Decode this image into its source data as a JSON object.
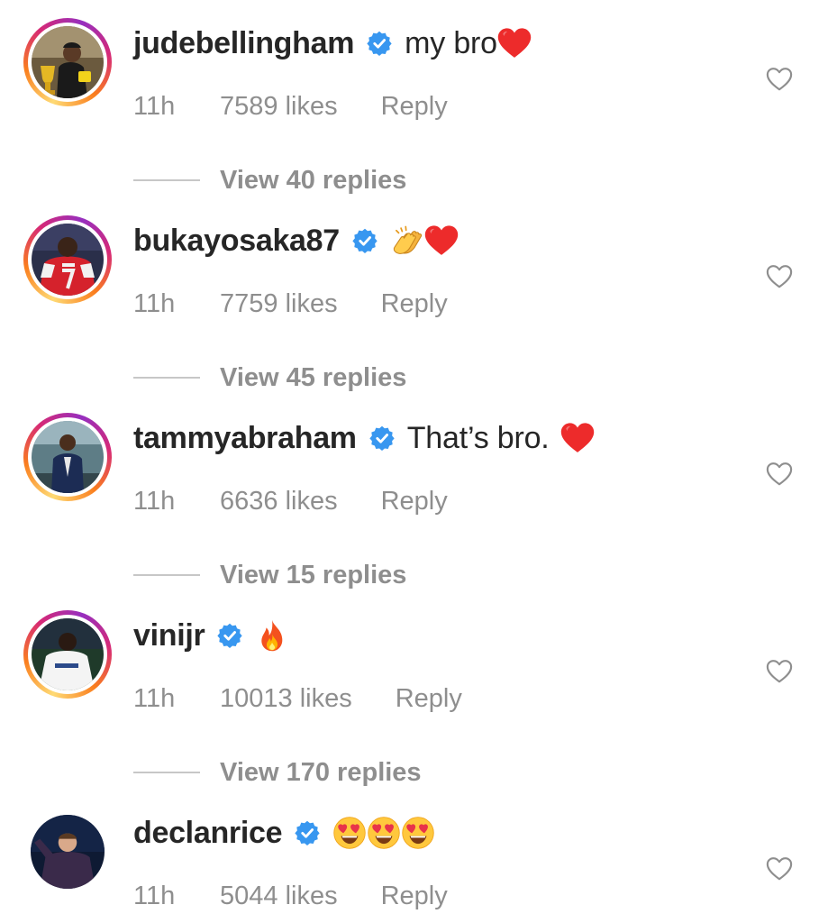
{
  "colors": {
    "text_primary": "#262626",
    "text_secondary": "#8e8e8e",
    "verified_blue": "#3897f0",
    "heart_red": "#ed2b2b",
    "story_ring": "gradient-instagram"
  },
  "comments": [
    {
      "username": "judebellingham",
      "verified": true,
      "text": "my bro",
      "emojis": [
        "red-heart"
      ],
      "time": "11h",
      "likes": "7589 likes",
      "reply_label": "Reply",
      "view_replies": "View 40 replies",
      "has_story_ring": true,
      "avatar_icon": "avatar-photo-trophy"
    },
    {
      "username": "bukayosaka87",
      "verified": true,
      "text": "",
      "emojis": [
        "clapping-hands",
        "red-heart"
      ],
      "time": "11h",
      "likes": "7759 likes",
      "reply_label": "Reply",
      "view_replies": "View 45 replies",
      "has_story_ring": true,
      "avatar_icon": "avatar-photo-jersey-7"
    },
    {
      "username": "tammyabraham",
      "verified": true,
      "text": "That’s bro.",
      "emojis": [
        "red-heart"
      ],
      "time": "11h",
      "likes": "6636 likes",
      "reply_label": "Reply",
      "view_replies": "View 15 replies",
      "has_story_ring": true,
      "avatar_icon": "avatar-photo-suit"
    },
    {
      "username": "vinijr",
      "verified": true,
      "text": "",
      "emojis": [
        "fire"
      ],
      "time": "11h",
      "likes": "10013 likes",
      "reply_label": "Reply",
      "view_replies": "View 170 replies",
      "has_story_ring": true,
      "avatar_icon": "avatar-photo-white-kit"
    },
    {
      "username": "declanrice",
      "verified": true,
      "text": "",
      "emojis": [
        "heart-eyes",
        "heart-eyes",
        "heart-eyes"
      ],
      "time": "11h",
      "likes": "5044 likes",
      "reply_label": "Reply",
      "view_replies": "",
      "has_story_ring": false,
      "avatar_icon": "avatar-photo-celebration"
    }
  ]
}
